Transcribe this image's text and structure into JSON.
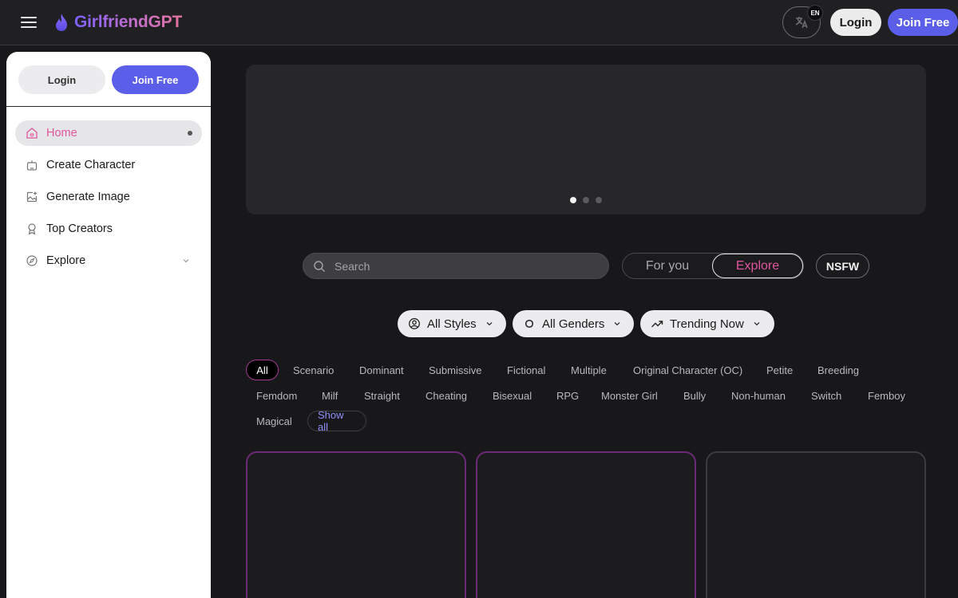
{
  "header": {
    "logo_text": "GirlfriendGPT",
    "lang_badge": "EN",
    "login_label": "Login",
    "join_label": "Join Free"
  },
  "sidebar": {
    "login_label": "Login",
    "join_label": "Join Free",
    "items": [
      {
        "label": "Home",
        "icon": "home-icon",
        "active": true
      },
      {
        "label": "Create Character",
        "icon": "robot-icon"
      },
      {
        "label": "Generate Image",
        "icon": "image-plus-icon"
      },
      {
        "label": "Top Creators",
        "icon": "award-icon"
      },
      {
        "label": "Explore",
        "icon": "compass-icon"
      }
    ]
  },
  "banner": {
    "slides": 3,
    "active_slide": 1
  },
  "search": {
    "placeholder": "Search"
  },
  "feed_toggle": {
    "for_you": "For you",
    "explore": "Explore",
    "selected": "Explore"
  },
  "nsfw_label": "NSFW",
  "filters": {
    "styles": "All Styles",
    "genders": "All Genders",
    "sort": "Trending Now"
  },
  "tags": [
    "All",
    "Scenario",
    "Dominant",
    "Submissive",
    "Fictional",
    "Multiple",
    "Original Character (OC)",
    "Petite",
    "Breeding",
    "Femdom",
    "Milf",
    "Straight",
    "Cheating",
    "Bisexual",
    "RPG",
    "Monster Girl",
    "Bully",
    "Non-human",
    "Switch",
    "Femboy",
    "Magical"
  ],
  "show_all_label": "Show all",
  "colors": {
    "accent": "#5b5ee8",
    "pink": "#e0569f",
    "background": "#18181b"
  }
}
